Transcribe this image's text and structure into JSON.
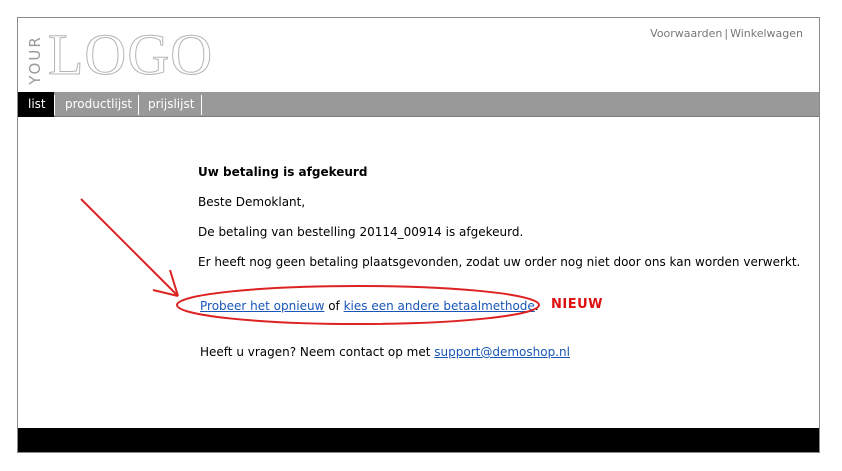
{
  "header": {
    "logo_your": "YOUR",
    "logo_main": "LOGO",
    "links": [
      "Voorwaarden",
      "Winkelwagen"
    ],
    "link_separator": "|"
  },
  "nav": {
    "items": [
      {
        "label": "list",
        "active": true
      },
      {
        "label": "productlijst",
        "active": false
      },
      {
        "label": "prijslijst",
        "active": false
      }
    ]
  },
  "message": {
    "title": "Uw betaling is afgekeurd",
    "greeting": "Beste  Demoklant,",
    "line1": "De betaling van bestelling 20114_00914 is afgekeurd.",
    "line2": "Er heeft nog geen betaling plaatsgevonden, zodat uw order nog niet door ons kan worden verwerkt.",
    "retry_link": "Probeer het opnieuw",
    "or_text": " of ",
    "other_method_link": "kies een andere betaalmethode",
    "period": ".",
    "contact_prefix": "Heeft u vragen? Neem contact op met ",
    "contact_email": "support@demoshop.nl"
  },
  "annotation": {
    "label": "NIEUW",
    "color": "#dd1111"
  },
  "colors": {
    "navbar": "#999999",
    "nav_active": "#000000",
    "footer": "#000000",
    "link": "#1a56b7"
  }
}
